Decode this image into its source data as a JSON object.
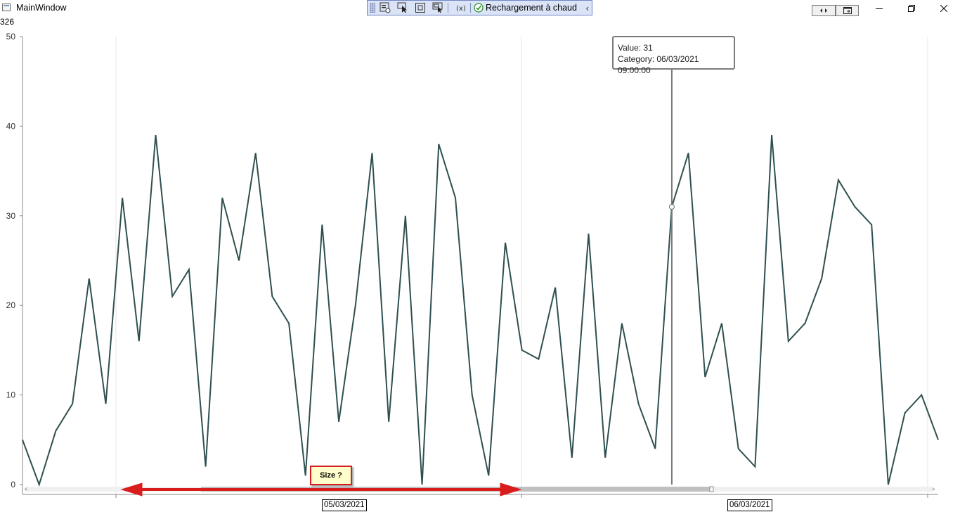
{
  "window": {
    "title": "MainWindow",
    "counter": "326",
    "minimize_icon": "minimize-icon",
    "maximize_icon": "restore-icon",
    "close_icon": "close-icon"
  },
  "toolbar": {
    "hot_reload_label": "Rechargement à chaud",
    "icons": [
      "live-visual-tree-icon",
      "select-element-icon",
      "display-adorners-icon",
      "track-focus-icon",
      "binding-failures-icon",
      "hot-reload-check-icon",
      "collapse-chevron-icon"
    ]
  },
  "tooltip": {
    "value_line": "Value: 31",
    "category_line": "Category: 06/03/2021 09:00:00"
  },
  "annotation": {
    "size_label": "Size ?",
    "arrow_color": "#d91c1c"
  },
  "colors": {
    "line": "#2f4f4f",
    "scrollbar": "#c0c0c0",
    "gridline": "#e6e6e6"
  },
  "chart_data": {
    "type": "line",
    "ylim": [
      0,
      50
    ],
    "yticks": [
      "0",
      "10",
      "20",
      "30",
      "40",
      "50"
    ],
    "x_labels": [
      "05/03/2021",
      "06/03/2021"
    ],
    "grid": "vertical",
    "values": [
      5,
      0,
      6,
      9,
      23,
      9,
      32,
      16,
      39,
      21,
      24,
      2,
      32,
      25,
      37,
      21,
      18,
      1,
      29,
      7,
      20,
      37,
      7,
      30,
      0,
      38,
      32,
      10,
      1,
      27,
      15,
      14,
      22,
      3,
      28,
      3,
      18,
      9,
      4,
      31,
      37,
      12,
      18,
      4,
      2,
      39,
      16,
      18,
      23,
      34,
      31,
      29,
      0,
      8,
      10,
      5
    ],
    "highlight_index": 39
  }
}
